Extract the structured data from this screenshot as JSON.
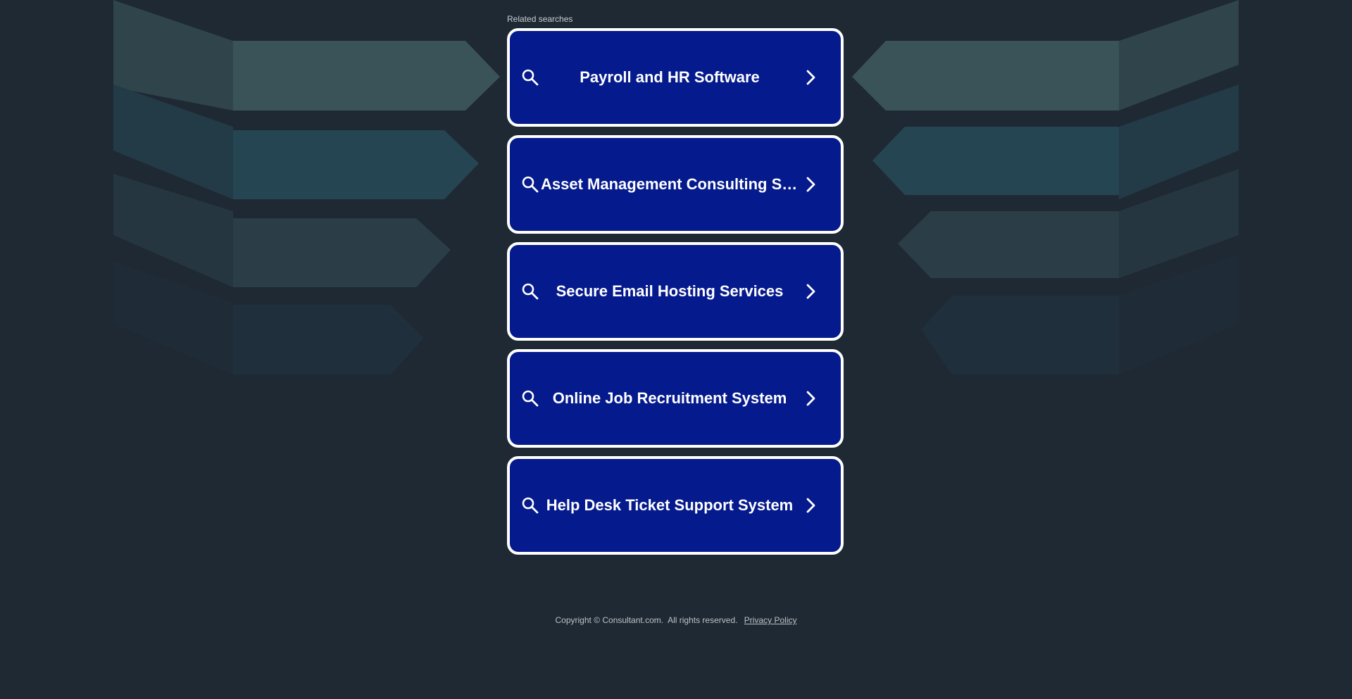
{
  "page": {
    "related_label": "Related searches",
    "results": [
      {
        "label": "Payroll and HR Software"
      },
      {
        "label": "Asset Management Consulting Services"
      },
      {
        "label": "Secure Email Hosting Services"
      },
      {
        "label": "Online Job Recruitment System"
      },
      {
        "label": "Help Desk Ticket Support System"
      }
    ],
    "icons": {
      "leading": "search-icon",
      "trailing": "chevron-right-icon"
    }
  },
  "footer": {
    "copyright": "Copyright © Consultant.com.  All rights reserved.",
    "privacy_link": "Privacy Policy"
  },
  "colors": {
    "background": "#1f2933",
    "button_fill": "#051a8c",
    "button_border": "#ffffff",
    "text": "#ffffff",
    "footer_text": "#bcc1c6"
  }
}
